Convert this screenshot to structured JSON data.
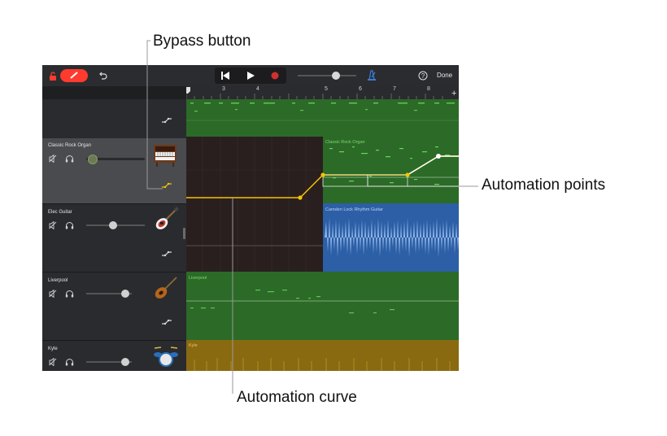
{
  "callouts": {
    "bypass": "Bypass button",
    "points": "Automation points",
    "curve": "Automation curve"
  },
  "toolbar": {
    "done_label": "Done",
    "accent_color": "#ff3b30",
    "icons": [
      "lock-icon",
      "pencil-icon",
      "undo-icon",
      "go-to-beginning-icon",
      "play-icon",
      "record-icon",
      "metronome-icon",
      "help-icon"
    ]
  },
  "ruler": {
    "bars": [
      "3",
      "4",
      "5",
      "6",
      "7",
      "8"
    ]
  },
  "tracks": [
    {
      "name": "",
      "color": "#2f6a2a",
      "volume": 0.0
    },
    {
      "name": "Classic Rock Organ",
      "region_label": "Classic Rock Organ",
      "color": "#2f6a2a",
      "volume": 0.1,
      "selected": true
    },
    {
      "name": "Elec Guitar",
      "region_label": "Camden Lock Rhythm Guitar",
      "color": "#2c5fa6",
      "volume": 0.45
    },
    {
      "name": "Liverpool",
      "region_label": "Liverpool",
      "color": "#2f6a2a",
      "volume": 0.7
    },
    {
      "name": "Kyle",
      "region_label": "Kyle",
      "color": "#8a6a10",
      "volume": 0.7
    }
  ],
  "automation_color": "#f5c400"
}
